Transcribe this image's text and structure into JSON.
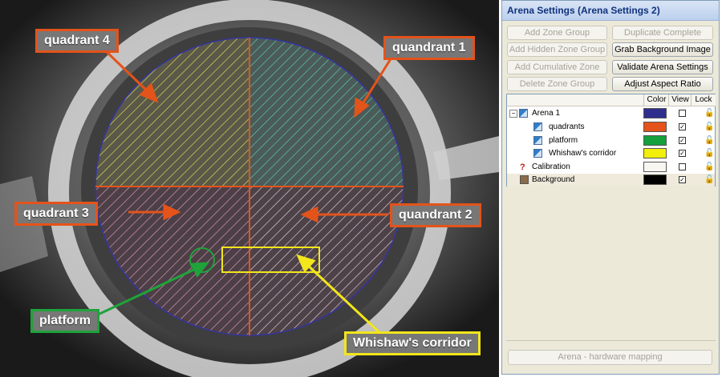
{
  "camera": {
    "callouts": {
      "quadrant4": "quadrant 4",
      "quadrant1": "quandrant 1",
      "quadrant3": "quadrant 3",
      "quadrant2": "quandrant 2",
      "platform": "platform",
      "corridor": "Whishaw's corridor"
    },
    "colors": {
      "orange": "#e4531a",
      "green": "#1fa33a",
      "yellow": "#f2e61c",
      "arena_outline": "#3535a0"
    }
  },
  "panel": {
    "title": "Arena Settings (Arena Settings 2)",
    "buttons": {
      "add_zone_group": "Add Zone Group",
      "duplicate_arena": "Duplicate Complete Arena",
      "add_hidden_zone_group": "Add Hidden Zone Group",
      "grab_background": "Grab Background Image",
      "add_cumulative_zone": "Add Cumulative Zone",
      "validate_settings": "Validate Arena Settings",
      "delete_zone_group": "Delete Zone Group",
      "adjust_aspect": "Adjust Aspect Ratio",
      "hardware_mapping": "Arena - hardware mapping"
    },
    "columns": {
      "color": "Color",
      "view": "View",
      "lock": "Lock"
    },
    "tree": {
      "arena": {
        "label": "Arena 1",
        "color": "#2e2e8c",
        "view": "☐"
      },
      "quadrants": {
        "label": "quadrants",
        "color": "#e4531a",
        "view": "☑"
      },
      "platform": {
        "label": "platform",
        "color": "#14a03c",
        "view": "☑"
      },
      "corridor": {
        "label": "Whishaw's corridor",
        "color": "#f2ef0c",
        "view": "☑"
      },
      "calibration": {
        "label": "Calibration",
        "color": "#f7f6f1",
        "view": "☐"
      },
      "background": {
        "label": "Background",
        "color": "#000000",
        "view": "☑"
      }
    },
    "icons": {
      "expand": "minus-box-icon",
      "lock": "unlock-icon",
      "calibration": "question-mark-icon"
    }
  }
}
